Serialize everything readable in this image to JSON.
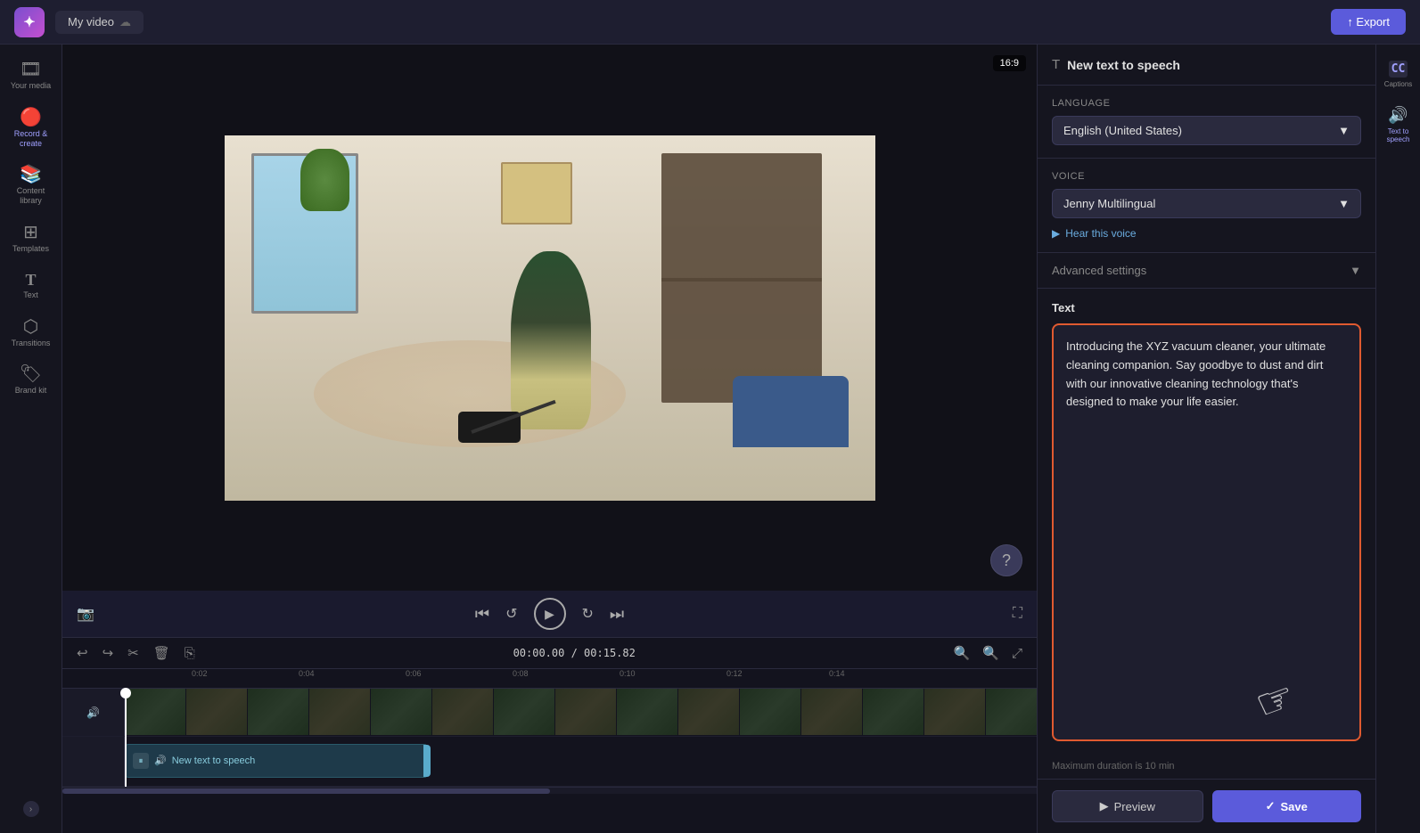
{
  "topbar": {
    "logo_text": "✦",
    "title": "My video",
    "export_label": "↑ Export"
  },
  "sidebar": {
    "items": [
      {
        "id": "your-media",
        "label": "Your media",
        "icon": "🎞"
      },
      {
        "id": "record-create",
        "label": "Record &\ncreate",
        "icon": "🔴"
      },
      {
        "id": "content-library",
        "label": "Content library",
        "icon": "📚"
      },
      {
        "id": "templates",
        "label": "Templates",
        "icon": "⊞"
      },
      {
        "id": "text",
        "label": "Text",
        "icon": "T"
      },
      {
        "id": "transitions",
        "label": "Transitions",
        "icon": "⬡"
      },
      {
        "id": "brand-kit",
        "label": "Brand kit",
        "icon": "🏷"
      }
    ]
  },
  "captions_sidebar": {
    "items": [
      {
        "id": "captions",
        "label": "Captions",
        "icon": "CC"
      },
      {
        "id": "tts",
        "label": "Text to speech",
        "icon": "🔊"
      }
    ]
  },
  "video_preview": {
    "aspect_ratio": "16:9"
  },
  "playback": {
    "current_time": "00:00.00",
    "total_time": "00:15.82"
  },
  "timeline": {
    "marks": [
      "0:02",
      "0:04",
      "0:06",
      "0:08",
      "0:10",
      "0:12",
      "0:14"
    ],
    "tts_track_label": "New text to speech"
  },
  "right_panel": {
    "title": "New text to speech",
    "language_label": "Language",
    "language_value": "English (United States)",
    "voice_label": "Voice",
    "voice_value": "Jenny Multilingual",
    "hear_voice_label": "Hear this voice",
    "advanced_settings_label": "Advanced settings",
    "text_label": "Text",
    "text_content": "Introducing the XYZ vacuum cleaner, your ultimate cleaning companion. Say goodbye to dust and dirt with our innovative cleaning technology that's designed to make your life easier.",
    "max_duration_note": "Maximum duration is 10 min",
    "preview_label": "Preview",
    "save_label": "Save"
  }
}
